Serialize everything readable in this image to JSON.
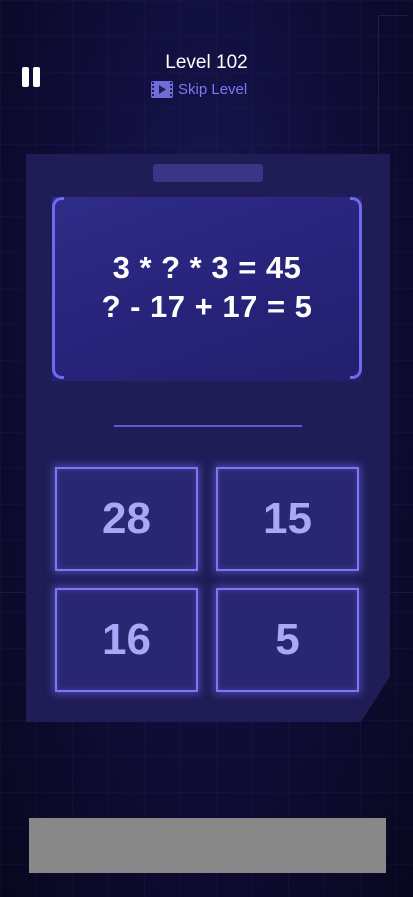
{
  "header": {
    "level_title": "Level 102",
    "skip_label": "Skip Level",
    "pause_icon": "pause-icon",
    "skip_icon": "video-play-icon"
  },
  "puzzle": {
    "equations": [
      "3 * ? * 3 = 45",
      "? - 17 + 17 = 5"
    ],
    "answer_placeholder": ""
  },
  "options": [
    {
      "label": "28"
    },
    {
      "label": "15"
    },
    {
      "label": "16"
    },
    {
      "label": "5"
    }
  ],
  "colors": {
    "background": "#0b0a2a",
    "panel": "#1f1c56",
    "accent": "#6d69f0",
    "option_text": "#a9a7f7",
    "skip_text": "#7d79f0",
    "ad_banner": "#888888"
  }
}
